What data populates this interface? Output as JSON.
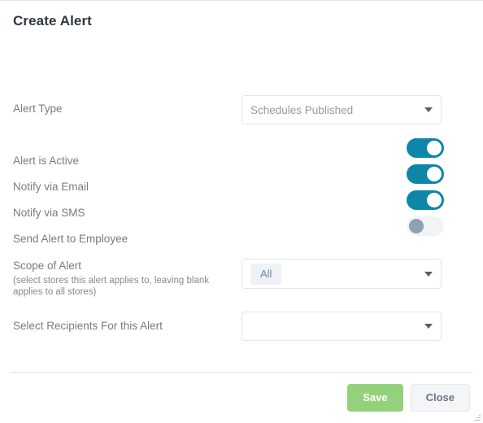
{
  "dialog": {
    "title": "Create Alert"
  },
  "fields": {
    "alert_type": {
      "label": "Alert Type",
      "value": "Schedules Published",
      "placeholder": "Schedules Published"
    },
    "alert_is_active": {
      "label": "Alert is Active",
      "state": "on"
    },
    "notify_via_email": {
      "label": "Notify via Email",
      "state": "on"
    },
    "notify_via_sms": {
      "label": "Notify via SMS",
      "state": "on"
    },
    "send_alert_to_employee": {
      "label": "Send Alert to Employee",
      "state": "off"
    },
    "scope_of_alert": {
      "label": "Scope of Alert",
      "hint": "(select stores this alert applies to, leaving blank applies to all stores)",
      "chip": "All"
    },
    "select_recipients": {
      "label": "Select Recipients For this Alert",
      "value": "",
      "placeholder": ""
    }
  },
  "footer": {
    "save_label": "Save",
    "close_label": "Close"
  },
  "colors": {
    "toggle_on": "#0e86a8",
    "toggle_off_track": "#f1f3f5",
    "toggle_off_knob": "#8fa1b3",
    "save_green": "#93d27a",
    "close_gray": "#f4f5f7",
    "chip_bg": "#eef1f5",
    "chip_text": "#6f88a8",
    "label_text": "#7b7b7b",
    "title_text": "#2f3640"
  },
  "icons": {
    "dropdown": "chevron-down-icon",
    "resize": "resize-handle-icon"
  }
}
